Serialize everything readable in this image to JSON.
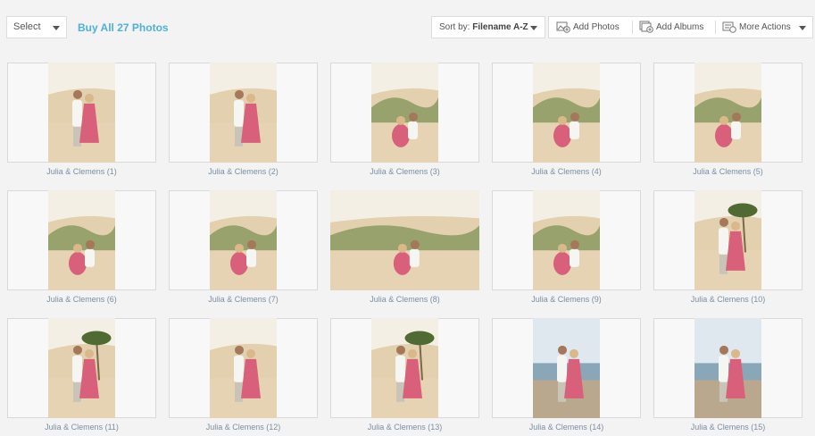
{
  "toolbar": {
    "select_label": "Select",
    "buy_label": "Buy All 27 Photos",
    "sort_prefix": "Sort by:",
    "sort_value": "Filename A-Z",
    "add_photos_label": "Add Photos",
    "add_albums_label": "Add Albums",
    "more_actions_label": "More Actions"
  },
  "photos": [
    {
      "caption": "Julia & Clemens (1)",
      "scene": "beach-portrait"
    },
    {
      "caption": "Julia & Clemens (2)",
      "scene": "beach-portrait"
    },
    {
      "caption": "Julia & Clemens (3)",
      "scene": "dune-sitting"
    },
    {
      "caption": "Julia & Clemens (4)",
      "scene": "dune-sitting"
    },
    {
      "caption": "Julia & Clemens (5)",
      "scene": "dune-sitting"
    },
    {
      "caption": "Julia & Clemens (6)",
      "scene": "dune-sitting"
    },
    {
      "caption": "Julia & Clemens (7)",
      "scene": "dune-sitting"
    },
    {
      "caption": "Julia & Clemens (8)",
      "scene": "dune-sitting-landscape"
    },
    {
      "caption": "Julia & Clemens (9)",
      "scene": "dune-sitting"
    },
    {
      "caption": "Julia & Clemens (10)",
      "scene": "palm-closeup"
    },
    {
      "caption": "Julia & Clemens (11)",
      "scene": "palm-dance"
    },
    {
      "caption": "Julia & Clemens (12)",
      "scene": "beach-dance"
    },
    {
      "caption": "Julia & Clemens (13)",
      "scene": "palm-dance"
    },
    {
      "caption": "Julia & Clemens (14)",
      "scene": "shore-walk"
    },
    {
      "caption": "Julia & Clemens (15)",
      "scene": "shore-walk"
    }
  ],
  "colors": {
    "accent": "#4fb0d8",
    "caption": "#7b8fa3",
    "dress": "#d9607a",
    "sand": "#e6d3b3"
  }
}
